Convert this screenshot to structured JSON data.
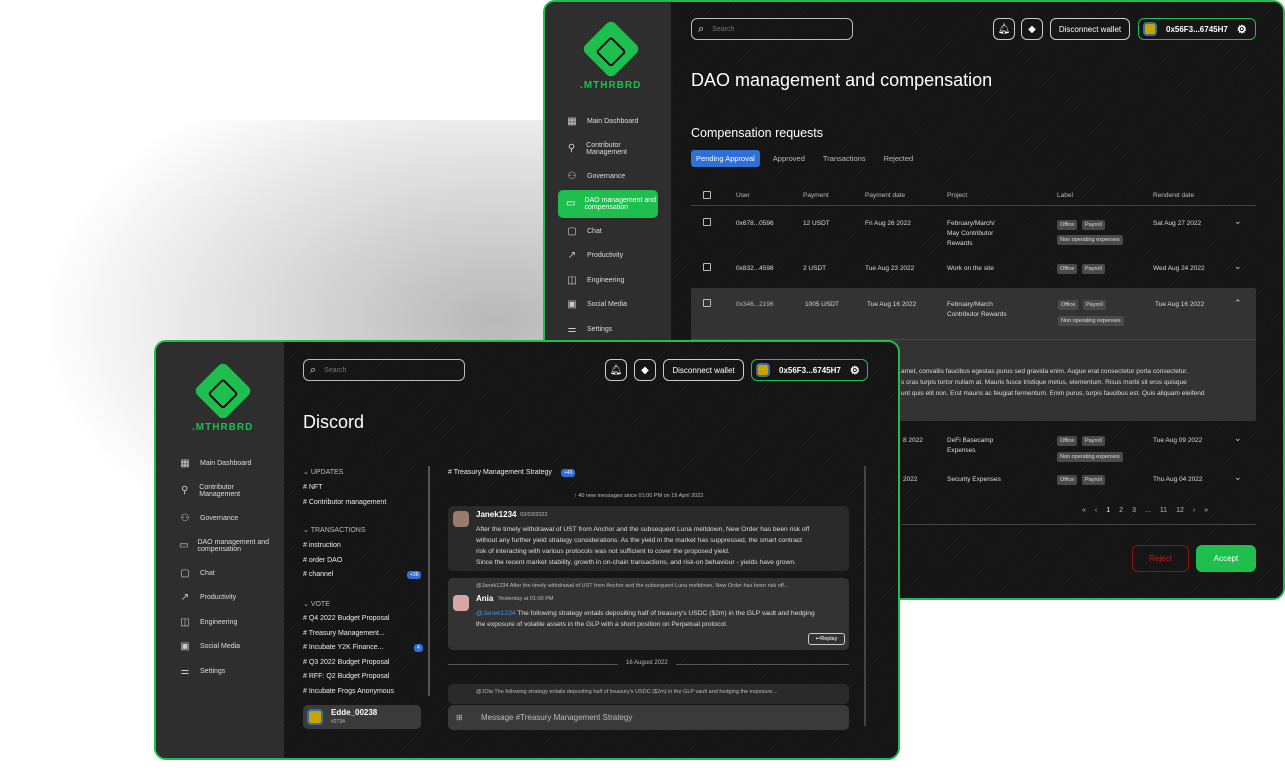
{
  "back": {
    "logo_text": ".MTHRBRD",
    "search_placeholder": "Search",
    "disconnect_label": "Disconnect wallet",
    "wallet_address": "0x56F3...6745H7",
    "page_title": "DAO management and compensation",
    "section_title": "Compensation requests",
    "tabs": [
      "Pending Approval",
      "Approved",
      "Transactions",
      "Rejected"
    ],
    "nav": [
      "Main Dashboard",
      "Contributor Management",
      "Governance",
      "DAO management and compensation",
      "Chat",
      "Productivity",
      "Engineering",
      "Social Media",
      "Settings"
    ],
    "columns": [
      "User",
      "Payment",
      "Payment date",
      "Project",
      "Label",
      "Renderet date"
    ],
    "rows": [
      {
        "user": "0x678...0596",
        "payment": "12 USDT",
        "pdate": "Fri Aug 26 2022",
        "project": "February/March/ May Contributor Rewards",
        "labels": [
          "Office",
          "Payroll",
          "Non operating expenses"
        ],
        "rdate": "Sat Aug 27 2022"
      },
      {
        "user": "0x832...4598",
        "payment": "2 USDT",
        "pdate": "Tue Aug 23 2022",
        "project": "Work on the site",
        "labels": [
          "Office",
          "Payroll"
        ],
        "rdate": "Wed Aug 24 2022"
      },
      {
        "user": "0x346...2196",
        "payment": "1005 USDT",
        "pdate": "Tue Aug 16 2022",
        "project": "February/March Contributor Rewards",
        "labels": [
          "Office",
          "Payroll",
          "Non operating expenses"
        ],
        "rdate": "Tue Aug 16 2022"
      },
      {
        "pdate": "8 2022",
        "project": "DeFi Basecamp Expenses",
        "labels": [
          "Office",
          "Payroll",
          "Non operating expenses"
        ],
        "rdate": "Tue Aug 09 2022"
      },
      {
        "pdate": "2022",
        "project": "Security Expenses",
        "labels": [
          "Office",
          "Payroll"
        ],
        "rdate": "Thu Aug 04 2022"
      }
    ],
    "expanded_text": [
      "amet, convallis faucibus egestas purus sed gravida enim. Augue erat consectetur porta consectetur.",
      "s cras turpis tortor nullam at. Mauris fusce tristique metus, elementum. Risus morbi sit eros quisque",
      "unt quis elit non. Erst mauris ac feugiat fermentum. Enim purus, turpis faucibus est. Quis aliquam eleifend"
    ],
    "pagination": [
      "«",
      "‹",
      "1",
      "2",
      "3",
      "...",
      "11",
      "12",
      "›",
      "»"
    ],
    "reject_label": "Reject",
    "accept_label": "Accept"
  },
  "front": {
    "logo_text": ".MTHRBRD",
    "search_placeholder": "Search",
    "disconnect_label": "Disconnect wallet",
    "wallet_address": "0x56F3...6745H7",
    "page_title": "Discord",
    "nav": [
      "Main Dashboard",
      "Contributor Management",
      "Governance",
      "DAO management and compensation",
      "Chat",
      "Productivity",
      "Engineering",
      "Social Media",
      "Settings"
    ],
    "sections": [
      {
        "title": "UPDATES",
        "items": [
          "NFT",
          "Contributor management"
        ]
      },
      {
        "title": "TRANSACTIONS",
        "items": [
          "instruction",
          "order DAO",
          "channel"
        ]
      },
      {
        "title": "VOTE",
        "items": [
          "Q4 2022 Budget Proposal",
          "Treasury Management...",
          "Incubate Y2K Finance...",
          "Q3 2022 Budget Proposal",
          "RFF: Q2 Budget Proposal",
          "Incubate Frogs Anonymous"
        ]
      }
    ],
    "channel_badge": "+36",
    "vote_badge": "4",
    "user_name": "Edde_00238",
    "user_tag": "#2734",
    "channel_title": "# Treasury Management Strategy",
    "channel_count": "+40",
    "new_messages": "40 new messages since 01:00 PM on 19 April 2022",
    "msg1": {
      "name": "Janek1234",
      "time": "03/03/2022",
      "lines": [
        "After the timely withdrawal of UST from Anchor and the subsequent Luna meltdown, New Order has been risk off",
        "without any further yield strategy considerations. As the yield in the market has suppressed, the smart contract",
        "risk of interacting with various protocols was not sufficient to cover the proposed yield.",
        "Since the recent market stability, growth in on-chain transactions, and risk-on behaviour - yields have grown."
      ]
    },
    "msg2": {
      "reply_ref": "@Janek1234 After the timely withdrawal of UST from Anchor and the subsequent Luna meltdown, New Order has been risk off...",
      "name": "Ania",
      "time": "Yesterday at 01:00 PM",
      "mention": "@Janek1234",
      "lines": [
        "The following strategy entails depositing half of treasury's USDC ($2m) in the GLP vault and hedging",
        "the exposure of volatile assets in the GLP with a short position on Perpetual protocol."
      ],
      "reply_label": "Replay"
    },
    "date_divider": "16 August 2022",
    "msg3_ref": "@JOla The following strategy entails depositing half of treasury's USDC ($2m) in the GLP vault and hedging the exposure...",
    "message_placeholder": "Message #Treasury Management Strategy"
  }
}
